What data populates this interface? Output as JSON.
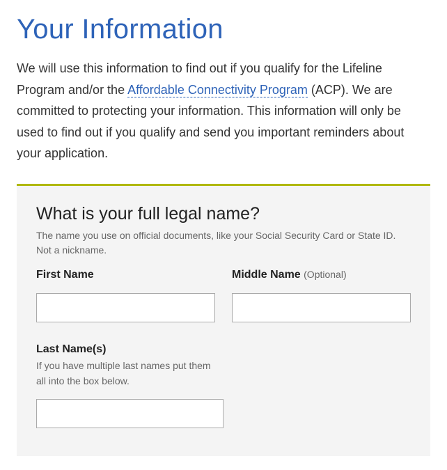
{
  "page": {
    "title": "Your Information",
    "intro_before": "We will use this information to find out if you qualify for the Lifeline Program and/or the ",
    "intro_link": "Affordable Connectivity Program",
    "intro_after": " (ACP). We are committed to protecting your information. This information will only be used to find out if you qualify and send you important reminders about your application."
  },
  "panel": {
    "heading": "What is your full legal name?",
    "helper": "The name you use on official documents, like your Social Security Card or State ID. Not a nickname.",
    "fields": {
      "first": {
        "label": "First Name"
      },
      "middle": {
        "label": "Middle Name ",
        "optional": "(Optional)"
      },
      "last": {
        "label": "Last Name(s)",
        "sub": "If you have multiple last names put them all into the box below."
      }
    }
  }
}
